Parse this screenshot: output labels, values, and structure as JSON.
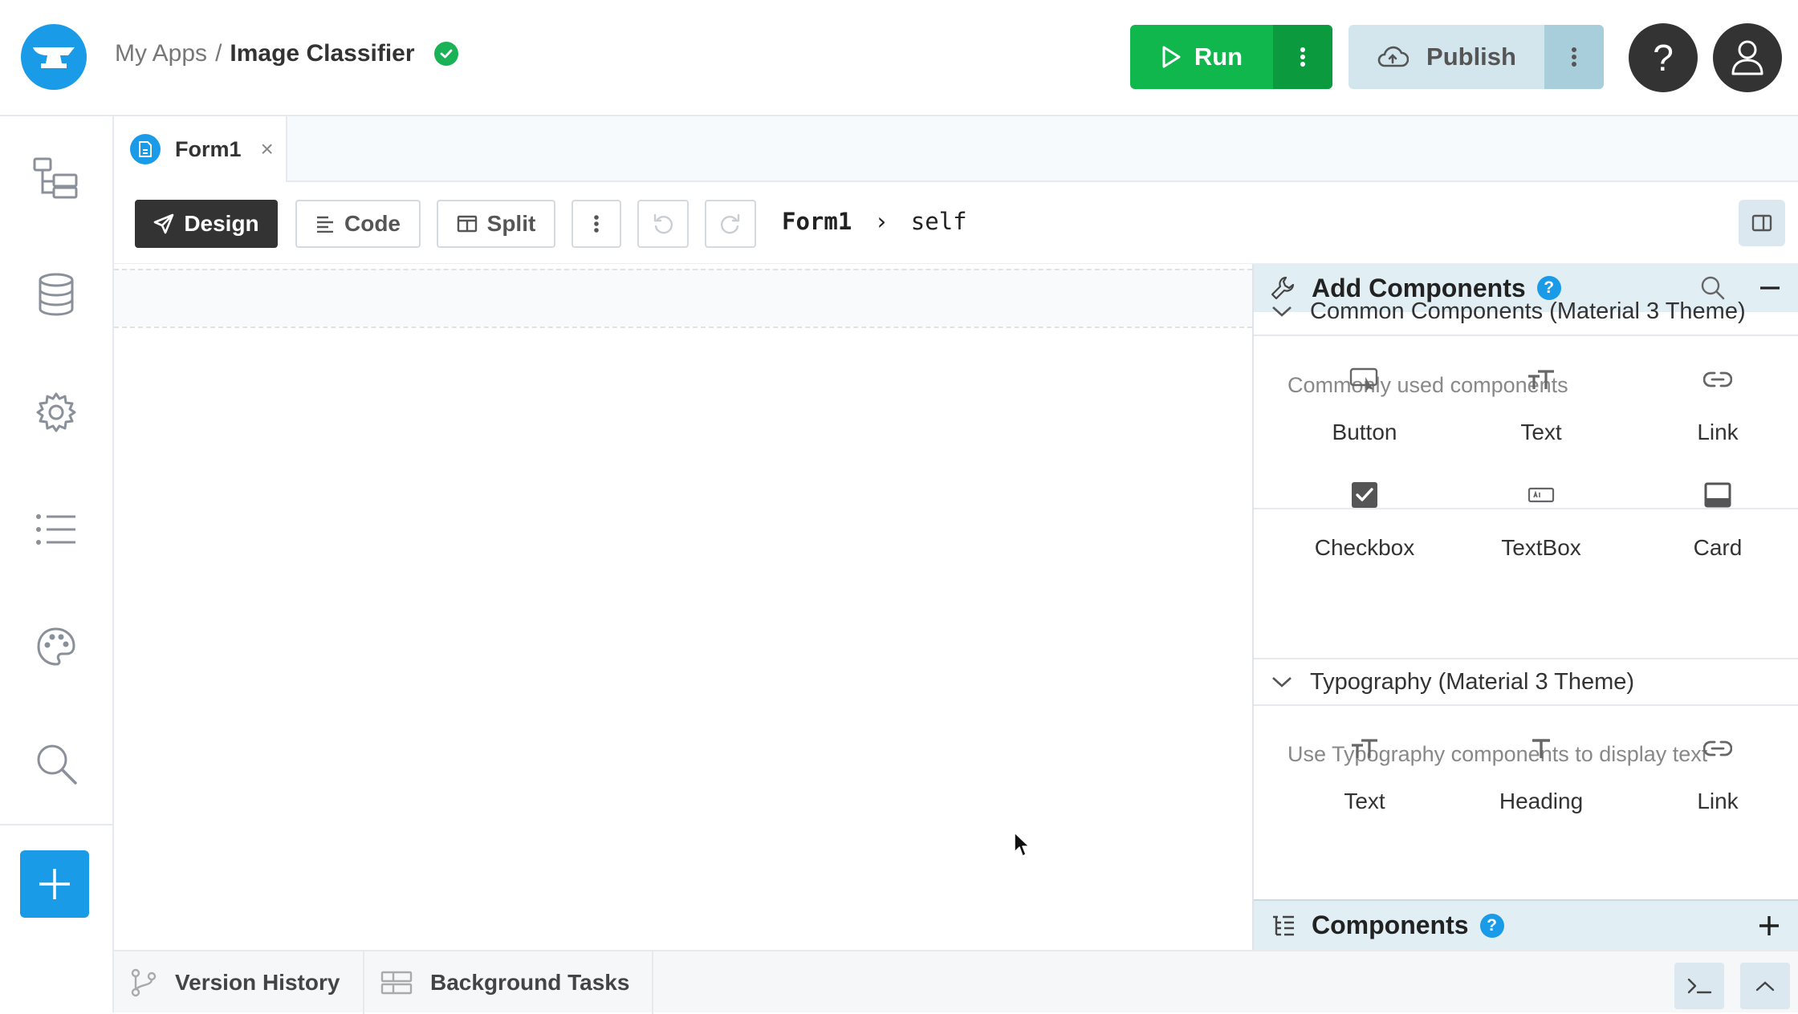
{
  "header": {
    "breadcrumb_root": "My Apps",
    "breadcrumb_sep": "/",
    "app_name": "Image Classifier",
    "run_label": "Run",
    "publish_label": "Publish",
    "help_label": "?"
  },
  "tab": {
    "label": "Form1",
    "close": "×"
  },
  "toolbar": {
    "design": "Design",
    "code": "Code",
    "split": "Split",
    "path_form": "Form1",
    "path_sep": "›",
    "path_self": "self"
  },
  "add_panel": {
    "title": "Add Components",
    "help": "?",
    "sections": [
      {
        "title": "Common Components (Material 3 Theme)",
        "description": "Commonly used components",
        "items": [
          {
            "label": "Button",
            "icon": "button-icon"
          },
          {
            "label": "Text",
            "icon": "text-icon"
          },
          {
            "label": "Link",
            "icon": "link-icon"
          },
          {
            "label": "Checkbox",
            "icon": "checkbox-icon"
          },
          {
            "label": "TextBox",
            "icon": "textbox-icon"
          },
          {
            "label": "Card",
            "icon": "card-icon"
          }
        ]
      },
      {
        "title": "Typography (Material 3 Theme)",
        "description": "Use Typography components to display text",
        "items": [
          {
            "label": "Text",
            "icon": "text-icon"
          },
          {
            "label": "Heading",
            "icon": "heading-icon"
          },
          {
            "label": "Link",
            "icon": "link-icon"
          }
        ]
      }
    ]
  },
  "components_panel": {
    "title": "Components",
    "help": "?"
  },
  "bottom": {
    "version_history": "Version History",
    "background_tasks": "Background Tasks"
  },
  "colors": {
    "accent": "#1a9be8",
    "run_green": "#0fb74c",
    "publish_bg": "#d3e6ee",
    "dark": "#333333"
  }
}
